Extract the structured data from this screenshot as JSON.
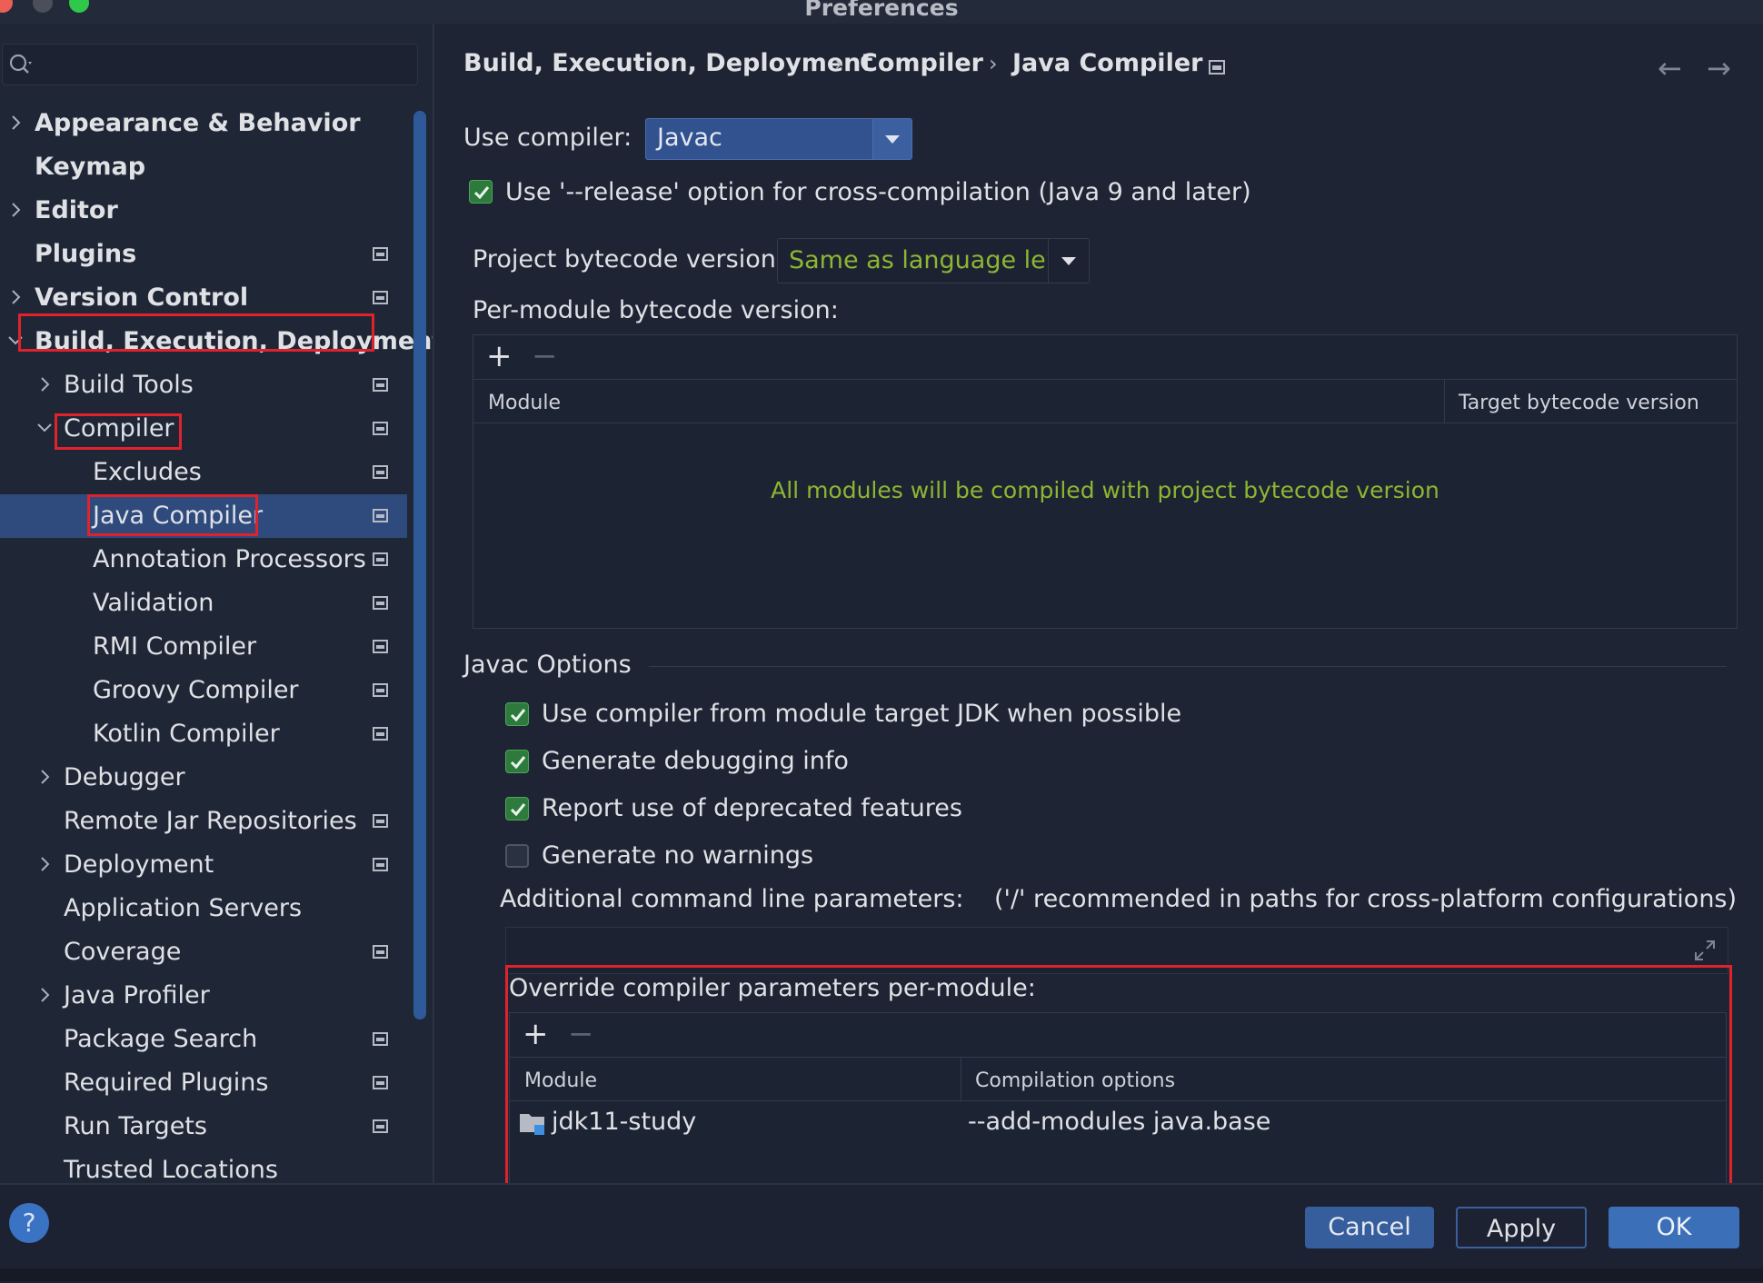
{
  "window": {
    "title": "Preferences"
  },
  "search": {
    "placeholder": ""
  },
  "sidebar": {
    "items": [
      {
        "label": "Appearance & Behavior",
        "bold": true,
        "level": 0,
        "chevron": "right"
      },
      {
        "label": "Keymap",
        "bold": true,
        "level": 0,
        "chevron": "none"
      },
      {
        "label": "Editor",
        "bold": true,
        "level": 0,
        "chevron": "right"
      },
      {
        "label": "Plugins",
        "bold": true,
        "level": 0,
        "chevron": "none",
        "project_icon": true
      },
      {
        "label": "Version Control",
        "bold": true,
        "level": 0,
        "chevron": "right",
        "project_icon": true
      },
      {
        "label": "Build, Execution, Deployment",
        "bold": true,
        "level": 0,
        "chevron": "down"
      },
      {
        "label": "Build Tools",
        "level": 1,
        "chevron": "right",
        "project_icon": true
      },
      {
        "label": "Compiler",
        "level": 1,
        "chevron": "down",
        "project_icon": true
      },
      {
        "label": "Excludes",
        "level": 2,
        "chevron": "none",
        "project_icon": true
      },
      {
        "label": "Java Compiler",
        "level": 2,
        "chevron": "none",
        "project_icon": true,
        "selected": true
      },
      {
        "label": "Annotation Processors",
        "level": 2,
        "chevron": "none",
        "project_icon": true
      },
      {
        "label": "Validation",
        "level": 2,
        "chevron": "none",
        "project_icon": true
      },
      {
        "label": "RMI Compiler",
        "level": 2,
        "chevron": "none",
        "project_icon": true
      },
      {
        "label": "Groovy Compiler",
        "level": 2,
        "chevron": "none",
        "project_icon": true
      },
      {
        "label": "Kotlin Compiler",
        "level": 2,
        "chevron": "none",
        "project_icon": true
      },
      {
        "label": "Debugger",
        "level": 1,
        "chevron": "right"
      },
      {
        "label": "Remote Jar Repositories",
        "level": 1,
        "chevron": "none",
        "project_icon": true
      },
      {
        "label": "Deployment",
        "level": 1,
        "chevron": "right",
        "project_icon": true
      },
      {
        "label": "Application Servers",
        "level": 1,
        "chevron": "none"
      },
      {
        "label": "Coverage",
        "level": 1,
        "chevron": "none",
        "project_icon": true
      },
      {
        "label": "Java Profiler",
        "level": 1,
        "chevron": "right"
      },
      {
        "label": "Package Search",
        "level": 1,
        "chevron": "none",
        "project_icon": true
      },
      {
        "label": "Required Plugins",
        "level": 1,
        "chevron": "none",
        "project_icon": true
      },
      {
        "label": "Run Targets",
        "level": 1,
        "chevron": "none",
        "project_icon": true
      },
      {
        "label": "Trusted Locations",
        "level": 1,
        "chevron": "none"
      }
    ]
  },
  "breadcrumb": [
    "Build, Execution, Deployment",
    "Compiler",
    "Java Compiler"
  ],
  "compiler": {
    "use_compiler_label": "Use compiler:",
    "use_compiler_value": "Javac",
    "release_option_label": "Use '--release' option for cross-compilation (Java 9 and later)",
    "release_option_checked": true,
    "bytecode_label": "Project bytecode version:",
    "bytecode_value": "Same as language level",
    "per_module_label": "Per-module bytecode version:",
    "per_module_table": {
      "col_module": "Module",
      "col_target": "Target bytecode version",
      "empty_text": "All modules will be compiled with project bytecode version"
    }
  },
  "javac": {
    "section_title": "Javac Options",
    "options": [
      {
        "label": "Use compiler from module target JDK when possible",
        "checked": true
      },
      {
        "label": "Generate debugging info",
        "checked": true
      },
      {
        "label": "Report use of deprecated features",
        "checked": true
      },
      {
        "label": "Generate no warnings",
        "checked": false
      }
    ],
    "additional_params_label": "Additional command line parameters:",
    "additional_params_hint": "('/' recommended in paths for cross-platform configurations)",
    "additional_params_value": "",
    "override_label": "Override compiler parameters per-module:",
    "override_table": {
      "col_module": "Module",
      "col_options": "Compilation options",
      "rows": [
        {
          "module": "jdk11-study",
          "options": "--add-modules java.base"
        }
      ]
    }
  },
  "buttons": {
    "cancel": "Cancel",
    "apply": "Apply",
    "ok": "OK",
    "help": "?"
  },
  "colors": {
    "accent": "#2f4a7d",
    "highlight_box": "#e0222c",
    "check_green": "#2d7a3c",
    "hint_green": "#8db632"
  },
  "icons": {
    "search": "search-icon",
    "project_scope": "project-scope-icon",
    "chevron_right": "chevron-right-icon",
    "chevron_down": "chevron-down-icon",
    "add": "plus-icon",
    "remove": "minus-icon",
    "expand": "expand-icon",
    "back": "arrow-left-icon",
    "forward": "arrow-right-icon",
    "module": "module-folder-icon"
  }
}
